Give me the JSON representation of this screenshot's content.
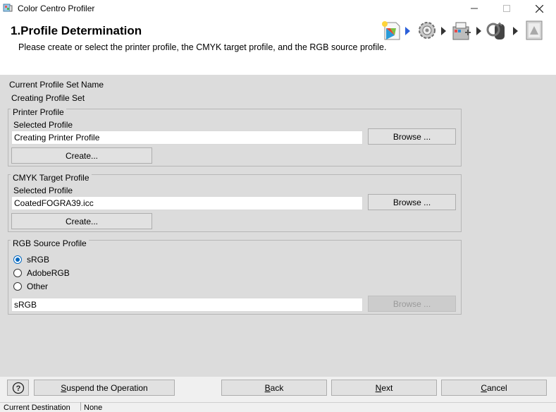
{
  "window": {
    "title": "Color Centro Profiler"
  },
  "header": {
    "step_title": "1.Profile Determination",
    "description": "Please create or select the printer profile, the CMYK target profile, and the RGB source profile."
  },
  "profile_set": {
    "label": "Current Profile Set Name",
    "value": "Creating Profile Set"
  },
  "printer_profile": {
    "legend": "Printer Profile",
    "selected_label": "Selected Profile",
    "value": "Creating Printer Profile",
    "browse_label": "Browse ...",
    "create_label": "Create..."
  },
  "cmyk_profile": {
    "legend": "CMYK Target Profile",
    "selected_label": "Selected Profile",
    "value": "CoatedFOGRA39.icc",
    "browse_label": "Browse ...",
    "create_label": "Create..."
  },
  "rgb_profile": {
    "legend": "RGB Source Profile",
    "options": [
      "sRGB",
      "AdobeRGB",
      "Other"
    ],
    "selected": "sRGB",
    "value": "sRGB",
    "browse_label": "Browse ..."
  },
  "footer": {
    "help_label": "?",
    "suspend_label": "Suspend the Operation",
    "back_label": "Back",
    "next_label": "Next",
    "cancel_label": "Cancel"
  },
  "status": {
    "label": "Current Destination",
    "value": "None"
  },
  "colors": {
    "accent": "#0067c0",
    "arrow": "#2b5fd9"
  }
}
